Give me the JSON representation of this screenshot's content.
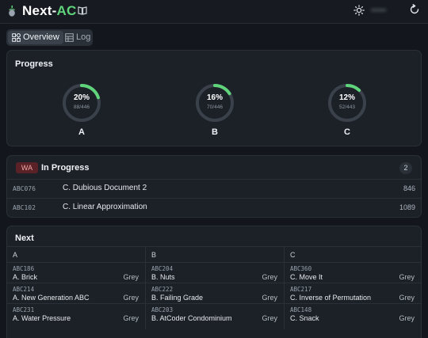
{
  "header": {
    "brand_main": "Next-",
    "brand_accent": "AC",
    "user_name": "••••••",
    "icons": [
      "acorn-logo-icon",
      "book-icon",
      "sun-icon",
      "reload-icon"
    ]
  },
  "tabs": [
    {
      "label": "Overview",
      "icon": "grid-icon",
      "active": true
    },
    {
      "label": "Log",
      "icon": "table-icon",
      "active": false
    }
  ],
  "progress": {
    "title": "Progress",
    "rings": [
      {
        "label": "A",
        "percent": "20%",
        "fraction": "88/446",
        "value": 0.2
      },
      {
        "label": "B",
        "percent": "16%",
        "fraction": "70/446",
        "value": 0.16
      },
      {
        "label": "C",
        "percent": "12%",
        "fraction": "52/443",
        "value": 0.12
      }
    ]
  },
  "in_progress": {
    "badge": "WA",
    "title": "In Progress",
    "count": "2",
    "rows": [
      {
        "id": "ABC076",
        "title": "C. Dubious Document 2",
        "score": "846"
      },
      {
        "id": "ABC102",
        "title": "C. Linear Approximation",
        "score": "1089"
      }
    ]
  },
  "next": {
    "title": "Next",
    "columns": [
      {
        "head": "A",
        "items": [
          {
            "id": "ABC186",
            "title": "A. Brick",
            "grade": "Grey"
          },
          {
            "id": "ABC214",
            "title": "A. New Generation ABC",
            "grade": "Grey"
          },
          {
            "id": "ABC231",
            "title": "A. Water Pressure",
            "grade": "Grey"
          }
        ]
      },
      {
        "head": "B",
        "items": [
          {
            "id": "ABC204",
            "title": "B. Nuts",
            "grade": "Grey"
          },
          {
            "id": "ABC222",
            "title": "B. Failing Grade",
            "grade": "Grey"
          },
          {
            "id": "ABC203",
            "title": "B. AtCoder Condominium",
            "grade": "Grey"
          }
        ]
      },
      {
        "head": "C",
        "items": [
          {
            "id": "ABC360",
            "title": "C. Move It",
            "grade": "Grey"
          },
          {
            "id": "ABC217",
            "title": "C. Inverse of Permutation",
            "grade": "Grey"
          },
          {
            "id": "ABC148",
            "title": "C. Snack",
            "grade": "Grey"
          }
        ]
      }
    ]
  },
  "colors": {
    "accent": "#5fd47a",
    "ring_track": "#3a414b",
    "wa_bg": "#5a2226",
    "wa_text": "#f0a7a7"
  }
}
